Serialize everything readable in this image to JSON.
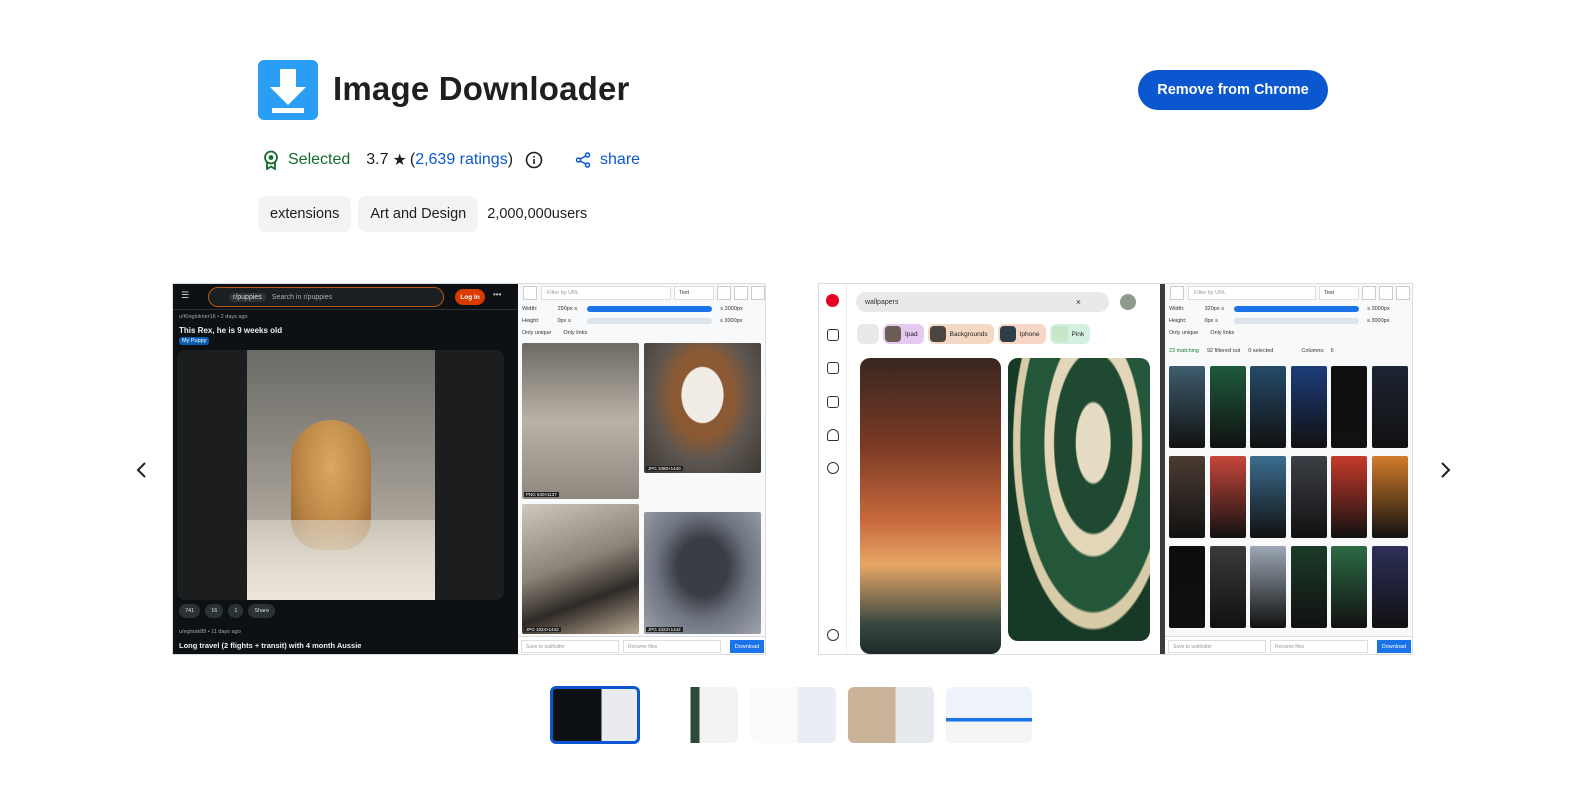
{
  "header": {
    "title": "Image Downloader",
    "remove_label": "Remove from Chrome",
    "icon": "download-arrow-icon",
    "accent_color": "#0b57d0",
    "icon_color": "#2a9df4"
  },
  "meta": {
    "selected_label": "Selected",
    "rating": "3.7",
    "ratings_link": "2,639 ratings",
    "share_label": "share"
  },
  "tags": {
    "category_1": "extensions",
    "category_2": "Art and Design",
    "users": "2,000,000users"
  },
  "slide1": {
    "reddit": {
      "subreddit": "r/puppies",
      "search_placeholder": "Search in r/puppies",
      "login": "Log In",
      "post_user": "u/Kinglokner16 • 2 days ago",
      "post_title": "This Rex, he is 9 weeks old",
      "flair": "My Puppy",
      "upvotes": "741",
      "comments": "16",
      "awards": "1",
      "share": "Share",
      "post2_user": "u/egmak88 • 11 days ago",
      "post2_title": "Long travel (2 flights + transit) with 4 month Aussie"
    },
    "ext": {
      "filter_placeholder": "Filter by URL",
      "select_value": "Text",
      "width_label": "Width:",
      "width_value": "290px ≤",
      "width_max": "≤ 3000px",
      "height_label": "Height:",
      "height_value": "0px ≤",
      "height_max": "≤ 3000px",
      "only_unique": "Only unique",
      "only_links": "Only links",
      "thumb1_label": "PNG  640×1137",
      "thumb2_label": "JPG  1080×1440",
      "thumb3_label": "JPG  1024×1442",
      "thumb4_label": "JPG  1024×1442",
      "subfolder_placeholder": "Save to subfolder",
      "rename_placeholder": "Rename files",
      "download": "Download"
    }
  },
  "slide2": {
    "pinterest": {
      "search_value": "wallpapers",
      "chips": [
        "Ipad",
        "Backgrounds",
        "Iphone",
        "Pink"
      ]
    },
    "ext": {
      "filter_placeholder": "Filter by URL",
      "select_value": "Text",
      "width_label": "Width:",
      "width_value": "320px ≤",
      "width_max": "≤ 3000px",
      "height_label": "Height:",
      "height_value": "0px ≤",
      "height_max": "≤ 3000px",
      "only_unique": "Only unique",
      "only_links": "Only links",
      "matching": "23 matching",
      "filtered_out": "92 filtered out",
      "selected": "0 selected",
      "columns_label": "Columns:",
      "columns_value": "6",
      "subfolder_placeholder": "Save to subfolder",
      "rename_placeholder": "Rename files",
      "download": "Download"
    }
  },
  "carousel": {
    "prev_icon": "chevron-left-icon",
    "next_icon": "chevron-right-icon",
    "thumbnails": 5,
    "active_index": 0
  }
}
